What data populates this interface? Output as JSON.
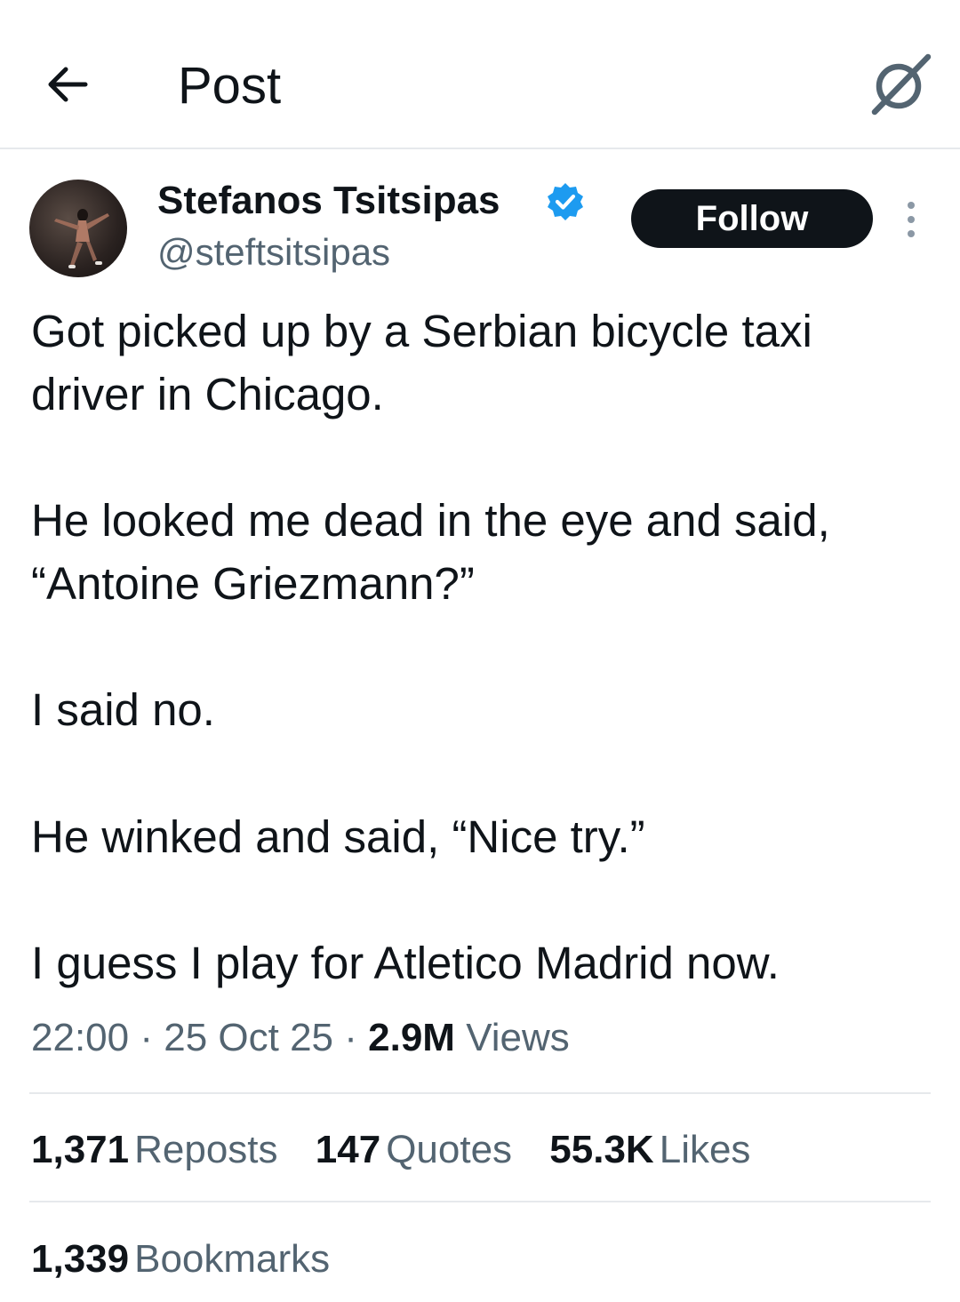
{
  "header": {
    "title": "Post",
    "back_icon": "arrow-left-icon",
    "grok_icon": "grok-icon"
  },
  "author": {
    "name": "Stefanos Tsitsipas",
    "handle": "@steftsitsipas",
    "verified_color": "#1d9bf0"
  },
  "follow_button": {
    "label": "Follow"
  },
  "post": {
    "lines": [
      "Got picked up by a Serbian bicycle taxi",
      "driver in Chicago.",
      "He looked me dead in the eye and said,",
      "“Antoine Griezmann?”",
      "I said no.",
      "He winked and said, “Nice try.”",
      "I guess I play for Atletico Madrid now."
    ]
  },
  "meta": {
    "time": "22:00",
    "separator": "·",
    "date": "25 Oct 25",
    "views_count": "2.9M",
    "views_label": "Views"
  },
  "stats": {
    "reposts_count": "1,371",
    "reposts_label": "Reposts",
    "quotes_count": "147",
    "quotes_label": "Quotes",
    "likes_count": "55.3K",
    "likes_label": "Likes",
    "bookmarks_count": "1,339",
    "bookmarks_label": "Bookmarks"
  }
}
